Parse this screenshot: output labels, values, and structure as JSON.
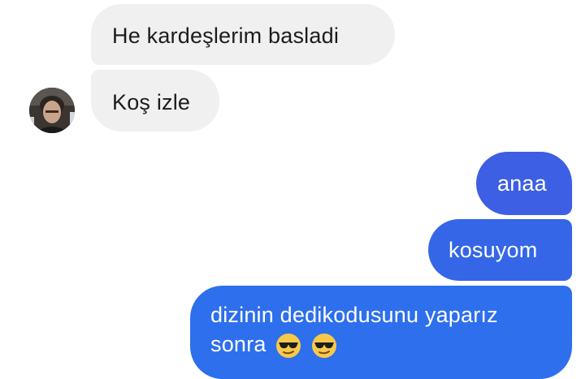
{
  "messages": {
    "incoming": [
      {
        "text": "He kardeşlerim basladi"
      },
      {
        "text": "Koş izle"
      }
    ],
    "outgoing": [
      {
        "text": "anaa"
      },
      {
        "text": "kosuyom"
      },
      {
        "text_line1": "dizinin dedikodusunu yaparız",
        "text_line2": "sonra",
        "emojis": [
          "sunglasses-emoji",
          "sunglasses-emoji"
        ]
      }
    ]
  },
  "colors": {
    "incoming_bubble": "#f0f0f0",
    "outgoing_bubble": "#2f6bea",
    "incoming_text": "#1c1c1c",
    "outgoing_text": "#ffffff"
  },
  "icons": [
    "contact-avatar",
    "sunglasses-emoji"
  ]
}
